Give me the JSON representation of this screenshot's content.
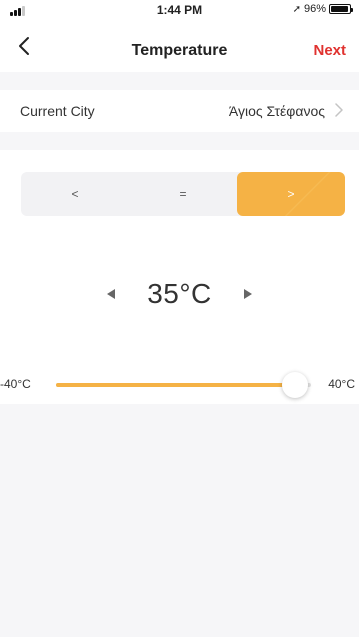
{
  "status_bar": {
    "time": "1:44 PM",
    "battery": "96%",
    "battery_level": 0.96,
    "icons": [
      "signal-icon",
      "location-arrow-icon",
      "battery-icon"
    ]
  },
  "nav": {
    "title": "Temperature",
    "next_label": "Next",
    "back_icon": "chevron-left-icon",
    "next_color": "#e0322f"
  },
  "city": {
    "label": "Current City",
    "value": "Άγιος Στέφανος",
    "icon": "chevron-right-icon"
  },
  "comparison": {
    "options": [
      {
        "label": "<",
        "active": false
      },
      {
        "label": "=",
        "active": false
      },
      {
        "label": ">",
        "active": true
      }
    ],
    "active_color": "#f5b245"
  },
  "temperature": {
    "value_label": "35°C",
    "decrease_icon": "triangle-left-icon",
    "increase_icon": "triangle-right-icon"
  },
  "slider": {
    "min_label": "-40°C",
    "max_label": "40°C",
    "min": -40,
    "max": 40,
    "value": 35,
    "fill_color": "#f5b245"
  }
}
